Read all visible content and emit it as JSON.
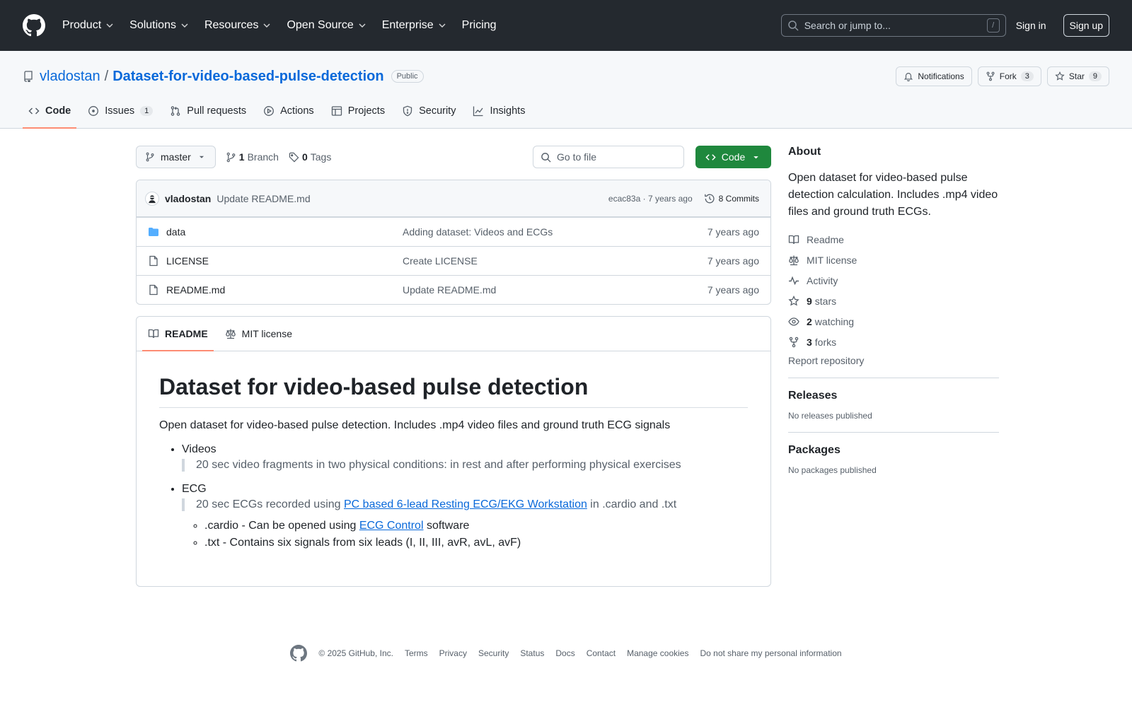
{
  "header": {
    "nav": [
      {
        "label": "Product",
        "has_menu": true
      },
      {
        "label": "Solutions",
        "has_menu": true
      },
      {
        "label": "Resources",
        "has_menu": true
      },
      {
        "label": "Open Source",
        "has_menu": true
      },
      {
        "label": "Enterprise",
        "has_menu": true
      },
      {
        "label": "Pricing",
        "has_menu": false
      }
    ],
    "search_placeholder": "Search or jump to...",
    "search_shortcut": "/",
    "sign_in": "Sign in",
    "sign_up": "Sign up"
  },
  "repo": {
    "owner": "vladostan",
    "separator": "/",
    "name": "Dataset-for-video-based-pulse-detection",
    "visibility": "Public",
    "notifications_label": "Notifications",
    "fork_label": "Fork",
    "fork_count": "3",
    "star_label": "Star",
    "star_count": "9"
  },
  "tabs": [
    {
      "label": "Code",
      "icon": "code-icon",
      "active": true
    },
    {
      "label": "Issues",
      "icon": "issue-icon",
      "count": "1"
    },
    {
      "label": "Pull requests",
      "icon": "pull-request-icon"
    },
    {
      "label": "Actions",
      "icon": "play-icon"
    },
    {
      "label": "Projects",
      "icon": "table-icon"
    },
    {
      "label": "Security",
      "icon": "shield-icon"
    },
    {
      "label": "Insights",
      "icon": "graph-icon"
    }
  ],
  "filebar": {
    "branch": "master",
    "branch_count": "1",
    "branch_label": "Branch",
    "tag_count": "0",
    "tag_label": "Tags",
    "goto_placeholder": "Go to file",
    "code_button": "Code"
  },
  "commit": {
    "author": "vladostan",
    "message": "Update README.md",
    "meta": "ecac83a · 7 years ago",
    "commits_label": "8 Commits"
  },
  "files": [
    {
      "name": "data",
      "type": "dir",
      "message": "Adding dataset: Videos and ECGs",
      "date": "7 years ago"
    },
    {
      "name": "LICENSE",
      "type": "file",
      "message": "Create LICENSE",
      "date": "7 years ago"
    },
    {
      "name": "README.md",
      "type": "file",
      "message": "Update README.md",
      "date": "7 years ago"
    }
  ],
  "readme": {
    "tab_readme": "README",
    "tab_license": "MIT license",
    "title": "Dataset for video-based pulse detection",
    "lead": "Open dataset for video-based pulse detection. Includes .mp4 video files and ground truth ECG signals",
    "videos_label": "Videos",
    "videos_quote": "20 sec video fragments in two physical conditions: in rest and after performing physical exercises",
    "ecg_label": "ECG",
    "ecg_quote_pre": "20 sec ECGs recorded using ",
    "ecg_quote_link": "PC based 6-lead Resting ECG/EKG Workstation",
    "ecg_quote_post": " in .cardio and .txt",
    "cardio_pre": ".cardio - Can be opened using ",
    "cardio_link": "ECG Control",
    "cardio_post": " software",
    "txt_item": ".txt - Contains six signals from six leads (I, II, III, avR, avL, avF)"
  },
  "about": {
    "heading": "About",
    "description": "Open dataset for video-based pulse detection calculation. Includes .mp4 video files and ground truth ECGs.",
    "readme": "Readme",
    "license": "MIT license",
    "activity": "Activity",
    "stars_count": "9",
    "stars_label": "stars",
    "watching_count": "2",
    "watching_label": "watching",
    "forks_count": "3",
    "forks_label": "forks",
    "report": "Report repository"
  },
  "releases": {
    "heading": "Releases",
    "empty": "No releases published"
  },
  "packages": {
    "heading": "Packages",
    "empty": "No packages published"
  },
  "footer": {
    "copyright": "© 2025 GitHub, Inc.",
    "links": [
      "Terms",
      "Privacy",
      "Security",
      "Status",
      "Docs",
      "Contact",
      "Manage cookies",
      "Do not share my personal information"
    ]
  }
}
